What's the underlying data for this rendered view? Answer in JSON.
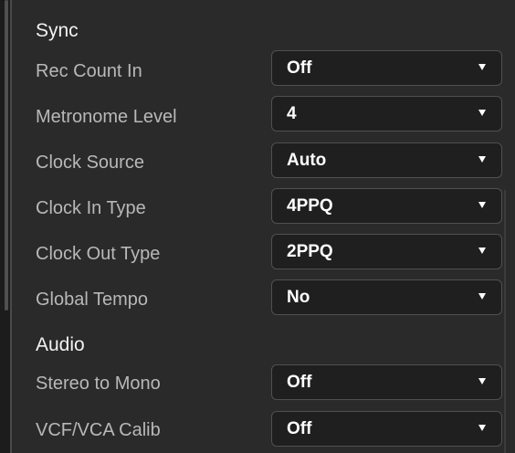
{
  "sections": {
    "sync": {
      "title": "Sync",
      "settings": [
        {
          "label": "Rec Count In",
          "value": "Off",
          "icon": "chevron-down-icon"
        },
        {
          "label": "Metronome Level",
          "value": "4",
          "icon": "chevron-down-icon"
        },
        {
          "label": "Clock Source",
          "value": "Auto",
          "icon": "chevron-down-icon"
        },
        {
          "label": "Clock In Type",
          "value": "4PPQ",
          "icon": "chevron-down-icon"
        },
        {
          "label": "Clock Out  Type",
          "value": "2PPQ",
          "icon": "chevron-down-icon"
        },
        {
          "label": "Global Tempo",
          "value": "No",
          "icon": "chevron-down-icon"
        }
      ]
    },
    "audio": {
      "title": "Audio",
      "settings": [
        {
          "label": "Stereo to Mono",
          "value": "Off",
          "icon": "chevron-down-icon"
        },
        {
          "label": "VCF/VCA Calib",
          "value": "Off",
          "icon": "chevron-down-icon"
        }
      ]
    }
  },
  "colors": {
    "background": "#2a2a2a",
    "dropdown_background": "#1f1f1f",
    "dropdown_border": "#505050",
    "label_text": "#b8b8b8",
    "value_text": "#ffffff"
  }
}
